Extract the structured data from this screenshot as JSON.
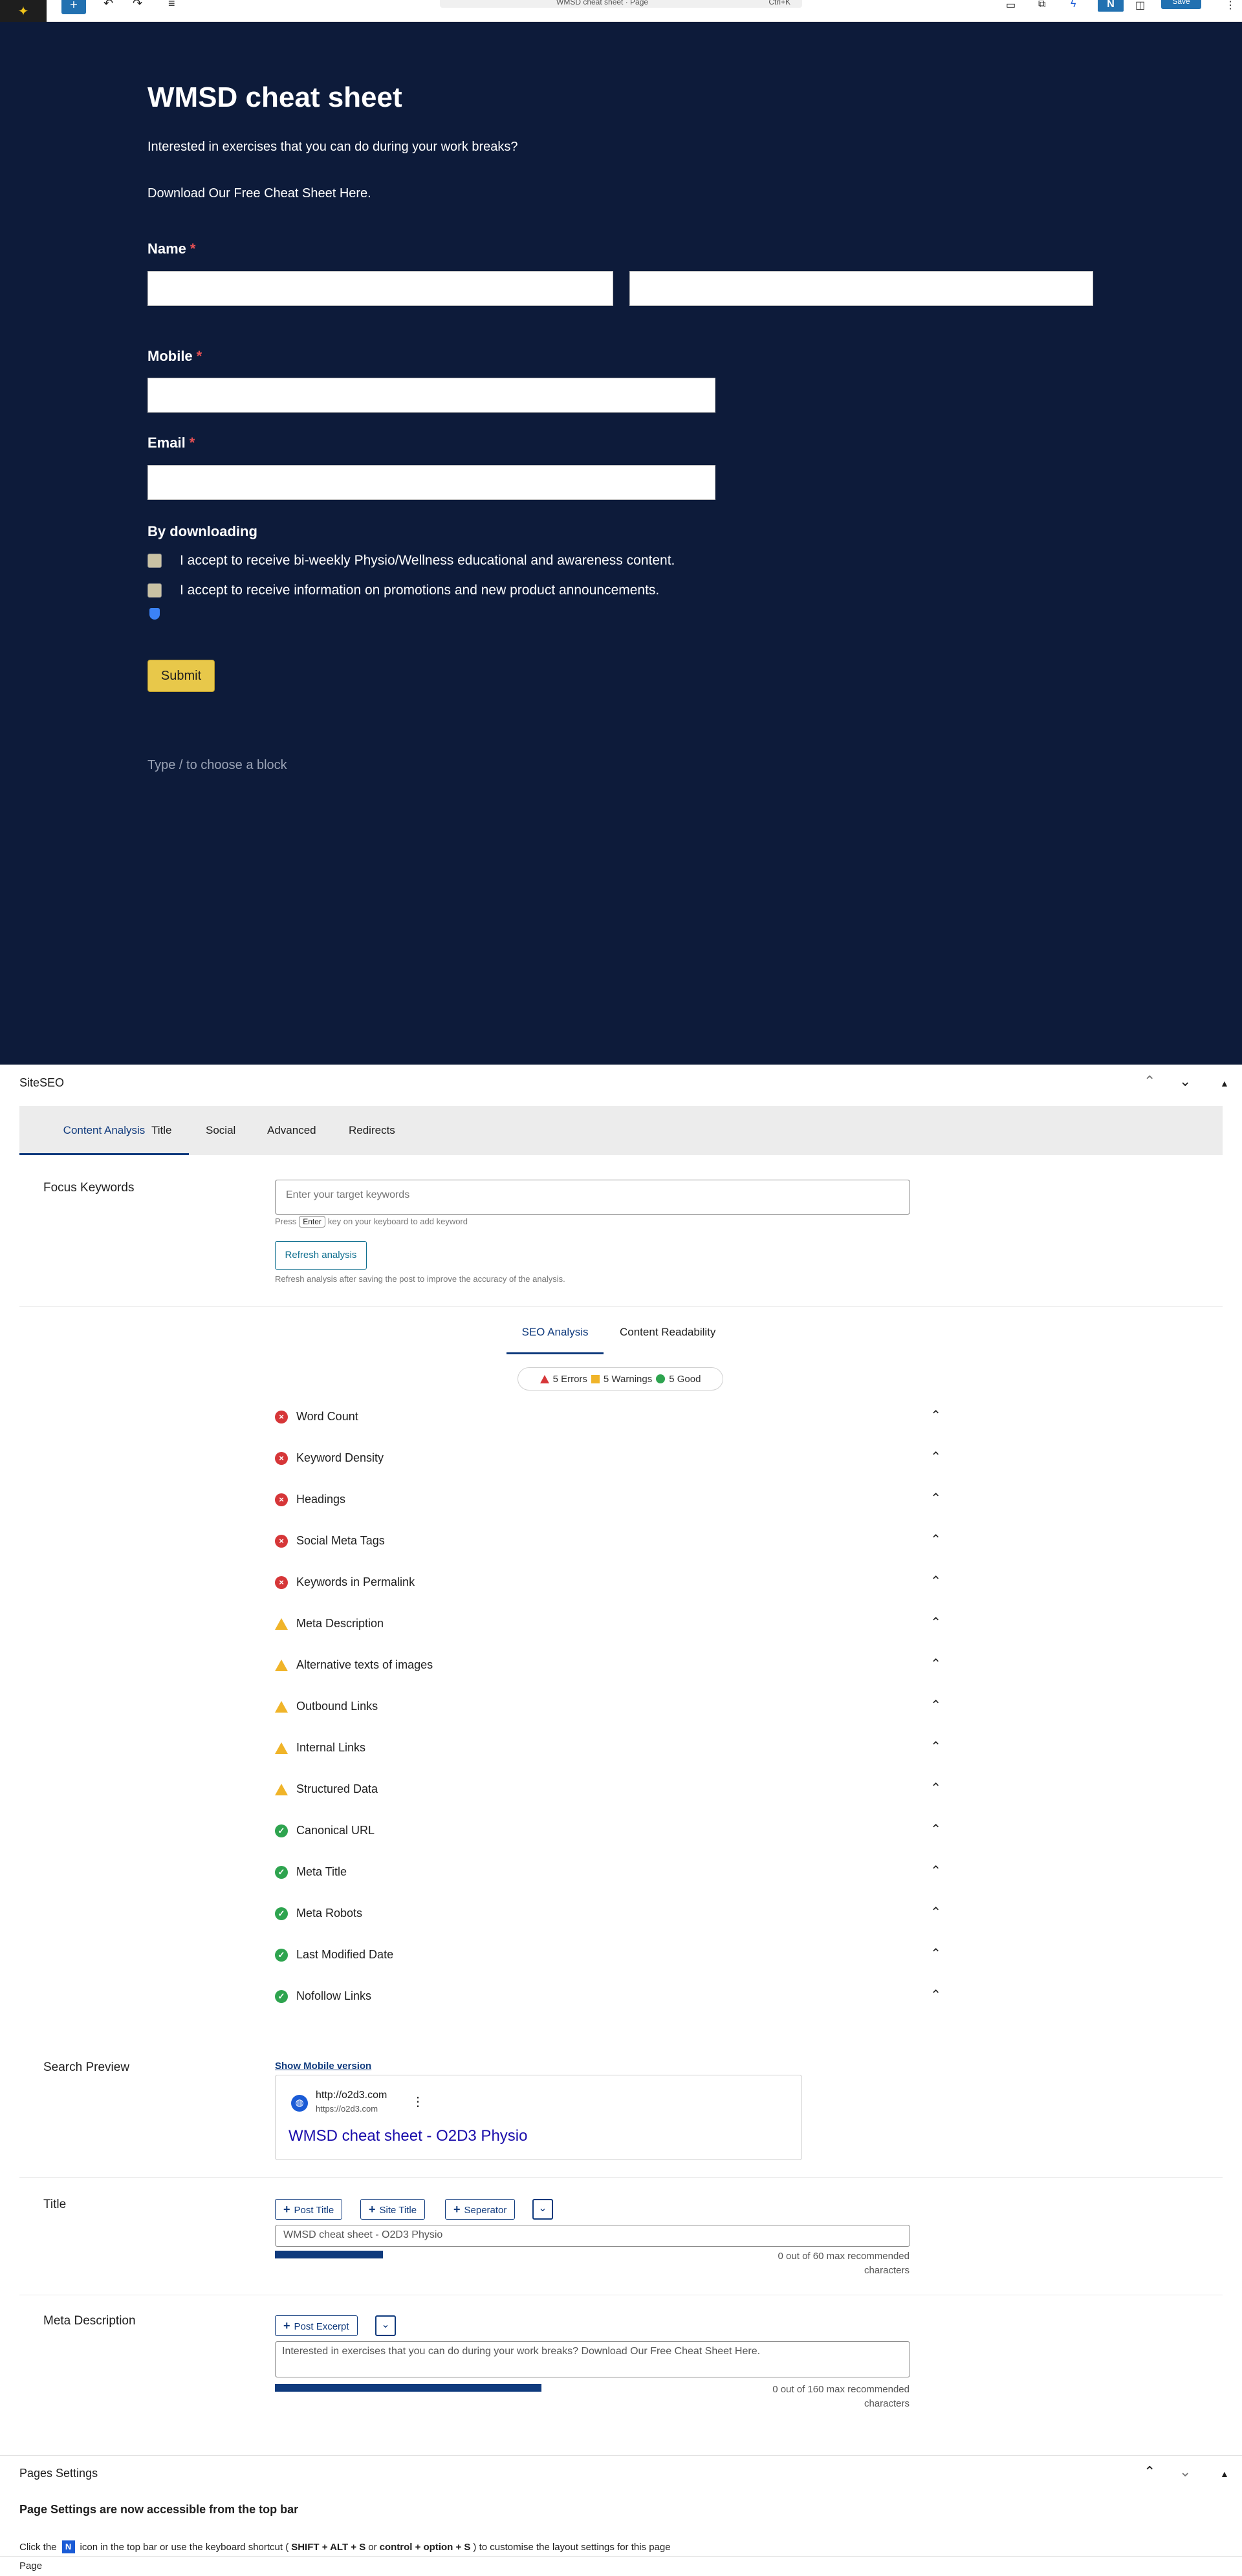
{
  "topbar": {
    "doc_title": "WMSD cheat sheet · Page",
    "shortcut": "Ctrl+K",
    "plus_label": "+",
    "save_label": "Save",
    "n_label": "N"
  },
  "canvas": {
    "heading": "WMSD cheat sheet",
    "intro": "Interested in exercises that you can do during your work breaks?",
    "download": "Download Our Free Cheat Sheet Here.",
    "name_label": "Name",
    "mobile_label": "Mobile",
    "email_label": "Email",
    "required_mark": "*",
    "by_downloading": "By downloading",
    "consent1": "I accept to receive bi-weekly Physio/Wellness educational and awareness content.",
    "consent2": "I accept to receive information on promotions and new product announcements.",
    "submit_label": "Submit",
    "type_hint": "Type / to choose a block"
  },
  "siteseo": {
    "panel_title": "SiteSEO",
    "tabs": [
      "Content Analysis",
      "Title",
      "Social",
      "Advanced",
      "Redirects"
    ],
    "focus_keywords_label": "Focus Keywords",
    "keywords_placeholder": "Enter your target keywords",
    "press_text": "Press",
    "enter_key": "Enter",
    "press_suffix": "key on your keyboard to add keyword",
    "refresh_label": "Refresh analysis",
    "refresh_note": "Refresh analysis after saving the post to improve the accuracy of the analysis.",
    "subtabs": [
      "SEO Analysis",
      "Content Readability"
    ],
    "summary": {
      "errors": "5 Errors",
      "warnings": "5 Warnings",
      "good": "5 Good"
    },
    "checks": [
      {
        "label": "Word Count",
        "status": "error"
      },
      {
        "label": "Keyword Density",
        "status": "error"
      },
      {
        "label": "Headings",
        "status": "error"
      },
      {
        "label": "Social Meta Tags",
        "status": "error"
      },
      {
        "label": "Keywords in Permalink",
        "status": "error"
      },
      {
        "label": "Meta Description",
        "status": "warning"
      },
      {
        "label": "Alternative texts of images",
        "status": "warning"
      },
      {
        "label": "Outbound Links",
        "status": "warning"
      },
      {
        "label": "Internal Links",
        "status": "warning"
      },
      {
        "label": "Structured Data",
        "status": "warning"
      },
      {
        "label": "Canonical URL",
        "status": "good"
      },
      {
        "label": "Meta Title",
        "status": "good"
      },
      {
        "label": "Meta Robots",
        "status": "good"
      },
      {
        "label": "Last Modified Date",
        "status": "good"
      },
      {
        "label": "Nofollow Links",
        "status": "good"
      }
    ],
    "search_preview_label": "Search Preview",
    "show_mobile": "Show Mobile version",
    "preview": {
      "domain": "http://o2d3.com",
      "url": "https://o2d3.com",
      "title": "WMSD cheat sheet - O2D3 Physio"
    },
    "title_label": "Title",
    "title_chips": [
      "Post Title",
      "Site Title",
      "Seperator"
    ],
    "title_value": "WMSD cheat sheet - O2D3 Physio",
    "title_counter": "0 out of 60 max recommended characters",
    "title_progress": 0.17,
    "meta_label": "Meta Description",
    "meta_chip": "Post Excerpt",
    "meta_value": "Interested in exercises that you can do during your work breaks? Download Our Free Cheat Sheet Here.",
    "meta_counter": "0 out of 160 max recommended characters",
    "meta_progress": 0.42
  },
  "pages_settings": {
    "panel_title": "Pages Settings",
    "heading": "Page Settings are now accessible from the top bar",
    "text_a": "Click the",
    "n_icon": "N",
    "text_b": "icon in the top bar or use the keyboard shortcut (",
    "shortcut1": "SHIFT + ALT + S",
    "text_or": "or",
    "shortcut2": "control + option + S",
    "text_c": ") to customise the layout settings for this page"
  },
  "footer": {
    "breadcrumb": "Page"
  },
  "colors": {
    "canvas_bg": "#0d1b3a",
    "accent": "#0f3a7d",
    "submit": "#e8c84a",
    "error": "#d63638",
    "warning": "#f0b429",
    "good": "#2ea44f"
  }
}
